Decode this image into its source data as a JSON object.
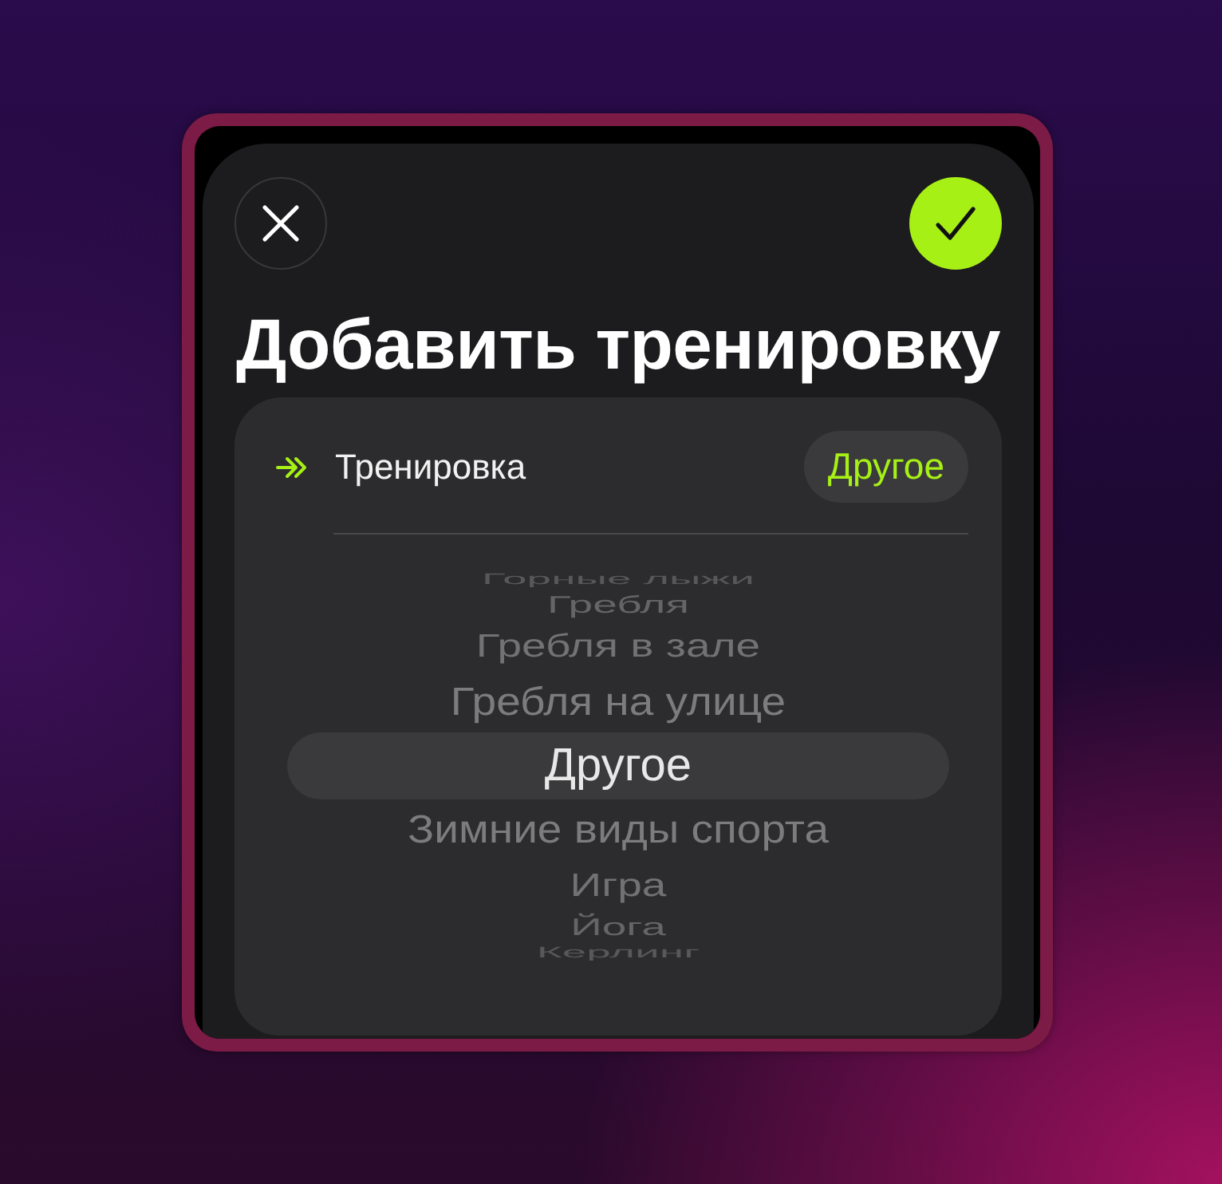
{
  "buttons": [
    {
      "kind": "close"
    },
    {
      "kind": "confirm"
    }
  ],
  "title": "Добавить тренировку",
  "field": {
    "label": "Тренировка",
    "value": "Другое"
  },
  "picker": {
    "items": [
      {
        "label": "Горные лыжи",
        "selected": false
      },
      {
        "label": "Гребля",
        "selected": false
      },
      {
        "label": "Гребля в зале",
        "selected": false
      },
      {
        "label": "Гребля на улице",
        "selected": false
      },
      {
        "label": "Другое",
        "selected": true
      },
      {
        "label": "Зимние виды спорта",
        "selected": false
      },
      {
        "label": "Игра",
        "selected": false
      },
      {
        "label": "Йога",
        "selected": false
      },
      {
        "label": "Керлинг",
        "selected": false
      }
    ]
  }
}
